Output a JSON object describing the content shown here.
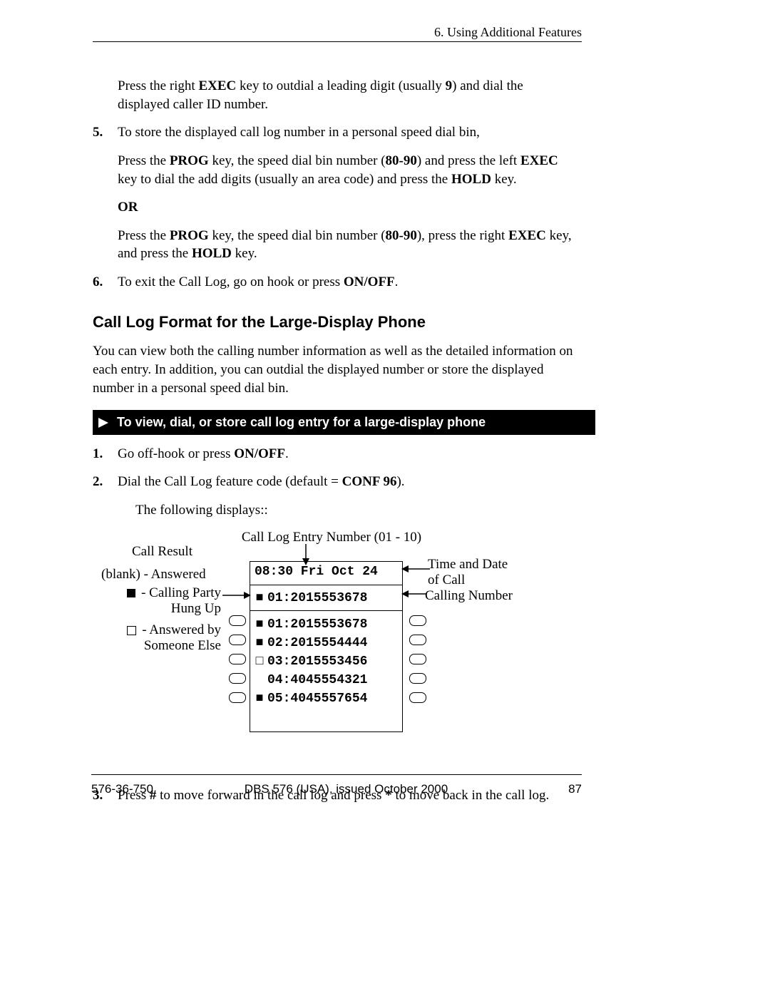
{
  "header": {
    "chapter": "6. Using Additional Features"
  },
  "body": {
    "p1a": "Press the right ",
    "p1b": "EXEC",
    "p1c": " key to outdial a leading digit (usually ",
    "p1d": "9",
    "p1e": ") and dial the displayed caller ID number.",
    "s5num": "5.",
    "s5text": "To store the displayed call log number in a personal speed dial bin,",
    "s5a1": "Press the  ",
    "s5a2": "PROG",
    "s5a3": " key, the speed dial bin number (",
    "s5a4": "80-90",
    "s5a5": ") and press the left ",
    "s5a6": "EXEC",
    "s5a7": " key to dial the add digits (usually an area code) and press the ",
    "s5a8": "HOLD",
    "s5a9": " key.",
    "or": "OR",
    "s5b1": "Press the ",
    "s5b2": "PROG",
    "s5b3": " key, the speed dial bin number (",
    "s5b4": "80-90",
    "s5b5": "), press the right ",
    "s5b6": "EXEC",
    "s5b7": " key, and press the ",
    "s5b8": "HOLD",
    "s5b9": " key.",
    "s6num": "6.",
    "s6a": "To exit the Call Log, go on hook or press ",
    "s6b": "ON/OFF",
    "s6c": ".",
    "heading": "Call Log Format for the Large-Display Phone",
    "intro": "You can view both the calling number information as well as the detailed information on each entry. In addition, you can outdial the displayed number or store the displayed number in a personal speed dial bin.",
    "bbar": "To view, dial, or store  call log entry for a large-display phone",
    "l1num": "1.",
    "l1a": "Go off-hook or press ",
    "l1b": "ON/OFF",
    "l1c": ".",
    "l2num": "2.",
    "l2a": "Dial the Call Log feature code (default = ",
    "l2b": "CONF 96",
    "l2c": ").",
    "follow": "The following displays::",
    "l3num": "3.",
    "l3a": "Press ",
    "l3b": "#",
    "l3c": " to move forward in the call log and press ",
    "l3d": "*",
    "l3e": " to move back in the call log."
  },
  "diagram": {
    "top_label": "Call Log Entry Number (01 - 10)",
    "call_result": "Call Result",
    "blank_answered": "(blank) - Answered",
    "calling_party": "- Calling Party",
    "hung_up": "Hung Up",
    "answered_by": "- Answered by",
    "someone_else": "Someone Else",
    "time_date1": "Time and Date",
    "time_date2": "of Call",
    "calling_number": "Calling Number",
    "lcd": {
      "datetime": "08:30 Fri Oct 24",
      "row_highlight": "01:2015553678",
      "rows": [
        {
          "sym": "■",
          "text": "01:2015553678"
        },
        {
          "sym": "■",
          "text": "02:2015554444"
        },
        {
          "sym": "□",
          "text": "03:2015553456"
        },
        {
          "sym": "",
          "text": "04:4045554321"
        },
        {
          "sym": "■",
          "text": "05:4045557654"
        }
      ]
    }
  },
  "footer": {
    "docnum": "576-36-750",
    "center": "DBS 576 (USA), issued October 2000",
    "page": "87"
  }
}
